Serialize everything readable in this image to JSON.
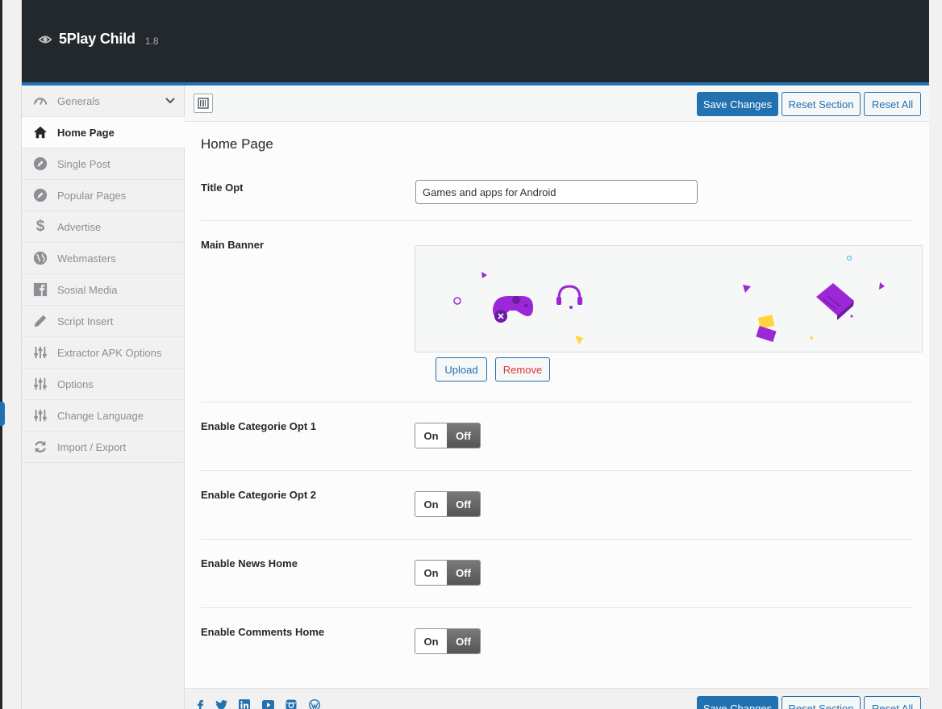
{
  "header": {
    "brand_name": "5Play Child",
    "version": "1.8"
  },
  "sidebar": {
    "items": [
      {
        "label": "Generals",
        "icon": "dashboard-gauge-icon"
      },
      {
        "label": "Home Page",
        "icon": "home-icon"
      },
      {
        "label": "Single Post",
        "icon": "pencil-circle-icon"
      },
      {
        "label": "Popular Pages",
        "icon": "pencil-circle-icon"
      },
      {
        "label": "Advertise",
        "icon": "dollar-icon"
      },
      {
        "label": "Webmasters",
        "icon": "globe-icon"
      },
      {
        "label": "Sosial Media",
        "icon": "facebook-icon"
      },
      {
        "label": "Script Insert",
        "icon": "pencil-icon"
      },
      {
        "label": "Extractor APK Options",
        "icon": "sliders-icon"
      },
      {
        "label": "Options",
        "icon": "sliders-icon"
      },
      {
        "label": "Change Language",
        "icon": "sliders-icon"
      },
      {
        "label": "Import / Export",
        "icon": "refresh-icon"
      }
    ],
    "active_index": 1
  },
  "toolbar": {
    "save_label": "Save Changes",
    "reset_section_label": "Reset Section",
    "reset_all_label": "Reset All"
  },
  "main": {
    "section_title": "Home Page",
    "title_opt": {
      "label": "Title Opt",
      "value": "Games and apps for Android"
    },
    "main_banner": {
      "label": "Main Banner",
      "upload_label": "Upload",
      "remove_label": "Remove"
    },
    "toggles": [
      {
        "label": "Enable Categorie Opt 1",
        "on_label": "On",
        "off_label": "Off",
        "state": "off"
      },
      {
        "label": "Enable Categorie Opt 2",
        "on_label": "On",
        "off_label": "Off",
        "state": "off"
      },
      {
        "label": "Enable News Home",
        "on_label": "On",
        "off_label": "Off",
        "state": "off"
      },
      {
        "label": "Enable Comments Home",
        "on_label": "On",
        "off_label": "Off",
        "state": "off"
      }
    ]
  },
  "footer": {
    "social_icons": [
      "facebook-icon",
      "twitter-icon",
      "linkedin-icon",
      "youtube-icon",
      "instagram-icon",
      "wordpress-icon"
    ],
    "save_label": "Save Changes",
    "reset_section_label": "Reset Section",
    "reset_all_label": "Reset All"
  },
  "colors": {
    "header_bg": "#23282d",
    "accent": "#2271b1",
    "toggle_off": "#6c6c6c",
    "remove_text": "#d63638",
    "banner_purple": "#9b27d6",
    "banner_yellow": "#ffd53d"
  }
}
